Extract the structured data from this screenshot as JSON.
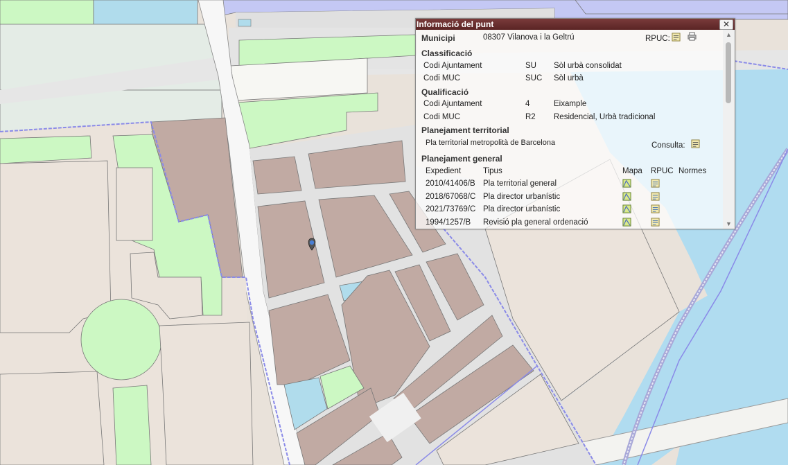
{
  "popup": {
    "title": "Informació del punt",
    "close_symbol": "✕",
    "municipi_label": "Municipi",
    "municipi_value": "08307 Vilanova i la Geltrú",
    "rpuc_label": "RPUC:",
    "classificacio": {
      "heading": "Classificació",
      "rows": [
        {
          "label": "Codi Ajuntament",
          "code": "SU",
          "desc": "Sòl urbà consolidat"
        },
        {
          "label": "Codi MUC",
          "code": "SUC",
          "desc": "Sòl urbà"
        }
      ]
    },
    "qualificacio": {
      "heading": "Qualificació",
      "rows": [
        {
          "label": "Codi Ajuntament",
          "code": "4",
          "desc": "Eixample"
        },
        {
          "label": "Codi MUC",
          "code": "R2",
          "desc": "Residencial, Urbà tradicional"
        }
      ]
    },
    "planejament_territorial": {
      "heading": "Planejament territorial",
      "plan": "Pla territorial metropolità de Barcelona",
      "consulta_label": "Consulta:"
    },
    "planejament_general": {
      "heading": "Planejament general",
      "columns": {
        "expedient": "Expedient",
        "tipus": "Tipus",
        "mapa": "Mapa",
        "rpuc": "RPUC",
        "normes": "Normes"
      },
      "rows": [
        {
          "expedient": "2010/41406/B",
          "tipus": "Pla territorial general"
        },
        {
          "expedient": "2018/67068/C",
          "tipus": "Pla director urbanístic"
        },
        {
          "expedient": "2021/73769/C",
          "tipus": "Pla director urbanístic"
        },
        {
          "expedient": "1994/1257/B",
          "tipus": "Revisió pla general ordenació"
        }
      ]
    },
    "scroll_up_symbol": "▲",
    "scroll_down_symbol": "▼"
  },
  "colors": {
    "urban_block": "#c1aaa3",
    "green_zone": "#ccf8c3",
    "water": "#b0dcec",
    "sea": "#b0dcf0",
    "residential_light": "#ebe3db",
    "road": "#e4e4e4",
    "boundary": "#8a8ae8",
    "purple_zone": "#c4c8f4",
    "title_bar": "#6b2e2e"
  },
  "icons": {
    "rpuc": "document-icon",
    "print": "printer-icon",
    "mapa": "map-icon",
    "marker": "location-pin-icon"
  }
}
